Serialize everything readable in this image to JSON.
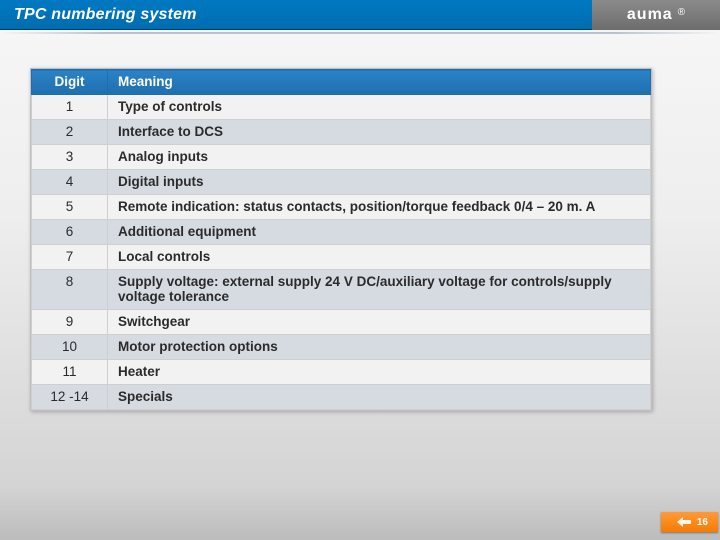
{
  "slide": {
    "title": "TPC numbering system",
    "brand": "auma",
    "reg": "®",
    "page_number": "16"
  },
  "table": {
    "headers": {
      "digit": "Digit",
      "meaning": "Meaning"
    },
    "rows": [
      {
        "digit": "1",
        "meaning": "Type of controls"
      },
      {
        "digit": "2",
        "meaning": "Interface to DCS"
      },
      {
        "digit": "3",
        "meaning": "Analog inputs"
      },
      {
        "digit": "4",
        "meaning": "Digital inputs"
      },
      {
        "digit": "5",
        "meaning": "Remote indication: status contacts, position/torque feedback 0/4 – 20 m. A"
      },
      {
        "digit": "6",
        "meaning": "Additional equipment"
      },
      {
        "digit": "7",
        "meaning": "Local controls"
      },
      {
        "digit": "8",
        "meaning": "Supply voltage: external supply 24 V DC/auxiliary voltage for controls/supply voltage tolerance"
      },
      {
        "digit": "9",
        "meaning": "Switchgear"
      },
      {
        "digit": "10",
        "meaning": "Motor protection options"
      },
      {
        "digit": "11",
        "meaning": "Heater"
      },
      {
        "digit": "12 -14",
        "meaning": "Specials"
      }
    ]
  }
}
